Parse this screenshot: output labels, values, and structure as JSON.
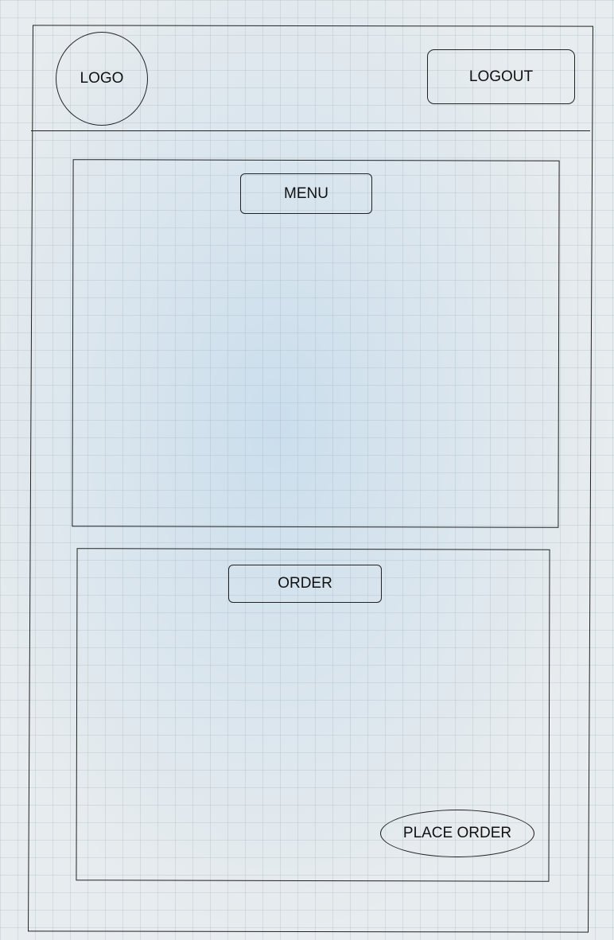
{
  "header": {
    "logo": "LOGO",
    "logout_label": "LOGOUT"
  },
  "menu": {
    "title": "MENU"
  },
  "order": {
    "title": "ORDER",
    "place_order_label": "PLACE ORDER"
  }
}
